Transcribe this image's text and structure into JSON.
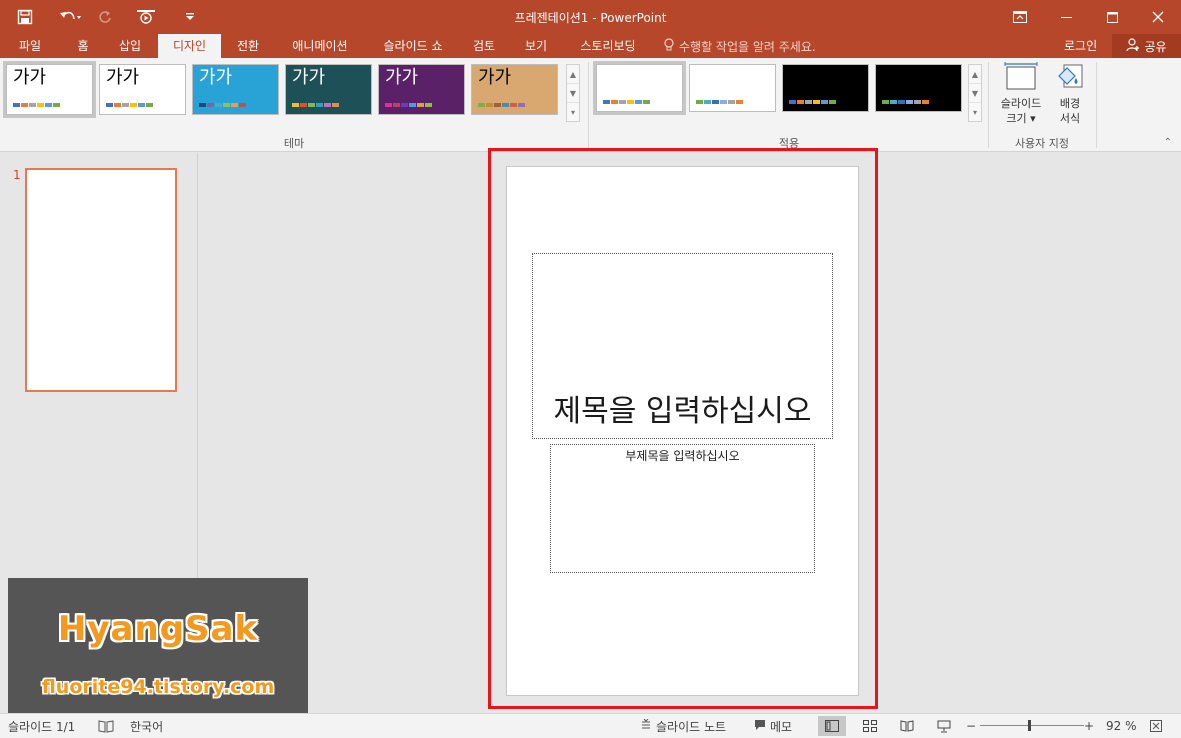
{
  "app": {
    "title": "프레젠테이션1 - PowerPoint",
    "accent": "#b7472a"
  },
  "qat": {
    "items": [
      {
        "name": "save-icon"
      },
      {
        "name": "undo-icon"
      },
      {
        "name": "redo-icon"
      },
      {
        "name": "start-from-beginning-icon"
      },
      {
        "name": "customize-qat-icon"
      }
    ]
  },
  "window": {
    "controls": [
      "ribbon-display-options-icon",
      "minimize-icon",
      "maximize-icon",
      "close-icon"
    ]
  },
  "tabs": [
    {
      "label": "파일"
    },
    {
      "label": "홈"
    },
    {
      "label": "삽입"
    },
    {
      "label": "디자인",
      "active": true
    },
    {
      "label": "전환"
    },
    {
      "label": "애니메이션"
    },
    {
      "label": "슬라이드 쇼"
    },
    {
      "label": "검토"
    },
    {
      "label": "보기"
    },
    {
      "label": "스토리보딩"
    }
  ],
  "tell_me": "수행할 작업을 알려 주세요.",
  "signin": "로그인",
  "share": "공유",
  "ribbon": {
    "themes": {
      "label": "테마",
      "thumb_text": "가가",
      "items": [
        {
          "bg": "#ffffff",
          "fg": "#000000",
          "swatches": [
            "#4472c4",
            "#ed7d31",
            "#a5a5a5",
            "#ffc000",
            "#5b9bd5",
            "#70ad47"
          ]
        },
        {
          "bg": "#ffffff",
          "fg": "#000000",
          "swatches": [
            "#4472c4",
            "#ed7d31",
            "#a5a5a5",
            "#ffc000",
            "#5b9bd5",
            "#70ad47"
          ]
        },
        {
          "bg": "#29a3d6",
          "fg": "#ffffff",
          "swatches": [
            "#1f497d",
            "#8064a2",
            "#4bacc6",
            "#9bbb59",
            "#f79646",
            "#c0504d"
          ]
        },
        {
          "bg": "#1e5058",
          "fg": "#ffffff",
          "swatches": [
            "#f0c020",
            "#e05030",
            "#7cb860",
            "#30a0c0",
            "#c070c0",
            "#e09040"
          ]
        },
        {
          "bg": "#5a2068",
          "fg": "#ffffff",
          "swatches": [
            "#e03090",
            "#c04060",
            "#6040c0",
            "#40a0e0",
            "#e0a040",
            "#90c040"
          ]
        },
        {
          "bg": "#d9a870",
          "fg": "#000000",
          "swatches": [
            "#7ab050",
            "#c09030",
            "#a06040",
            "#4090b0",
            "#d06040",
            "#9070b0"
          ]
        }
      ]
    },
    "variants": {
      "label": "적용",
      "items": [
        {
          "bg": "#ffffff",
          "swatches": [
            "#4472c4",
            "#ed7d31",
            "#a5a5a5",
            "#ffc000",
            "#5b9bd5",
            "#70ad47"
          ]
        },
        {
          "bg": "#ffffff",
          "swatches": [
            "#70ad47",
            "#4bacc6",
            "#2e75b6",
            "#8faadc",
            "#a5a5a5",
            "#ed7d31"
          ]
        },
        {
          "bg": "#000000",
          "swatches": [
            "#4472c4",
            "#ed7d31",
            "#a5a5a5",
            "#ffc000",
            "#5b9bd5",
            "#70ad47"
          ]
        },
        {
          "bg": "#000000",
          "swatches": [
            "#70ad47",
            "#4bacc6",
            "#2e75b6",
            "#8faadc",
            "#a5a5a5",
            "#ed7d31"
          ]
        }
      ]
    },
    "customize": {
      "label": "사용자 지정",
      "slide_size_line1": "슬라이드",
      "slide_size_line2": "크기",
      "format_bg_line1": "배경",
      "format_bg_line2": "서식"
    }
  },
  "thumbnails": {
    "slide_number": "1"
  },
  "slide": {
    "title_placeholder": "제목을 입력하십시오",
    "subtitle_placeholder": "부제목을 입력하십시오"
  },
  "watermark": {
    "name": "HyangSak",
    "url": "fluorite94.tistory.com"
  },
  "status": {
    "slide_count": "슬라이드 1/1",
    "language": "한국어",
    "notes": "슬라이드 노트",
    "comments": "메모",
    "zoom": "92 %",
    "zoom_fraction": 0.46
  }
}
